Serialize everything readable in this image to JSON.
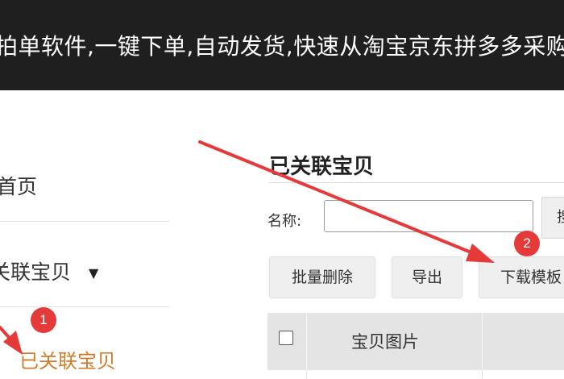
{
  "banner": {
    "text": "拍单软件,一键下单,自动发货,快速从淘宝京东拼多多采购"
  },
  "sidebar": {
    "items": [
      {
        "label": "首页"
      },
      {
        "label": "关联宝贝",
        "caret": "▼"
      },
      {
        "label": "已关联宝贝",
        "active": true
      }
    ]
  },
  "main": {
    "title": "已关联宝贝",
    "filter": {
      "name_label": "名称:",
      "name_value": "",
      "search_button": "搜索"
    },
    "toolbar": {
      "batch_delete": "批量删除",
      "export": "导出",
      "download_template": "下载模板"
    },
    "table": {
      "columns": [
        "宝贝图片"
      ]
    }
  },
  "annotations": {
    "marker1": "1",
    "marker2": "2"
  },
  "colors": {
    "banner_bg": "#1f1f1f",
    "active_nav": "#d07b28",
    "arrow_red": "#e53a3a",
    "table_header": "#e4e4e4"
  }
}
